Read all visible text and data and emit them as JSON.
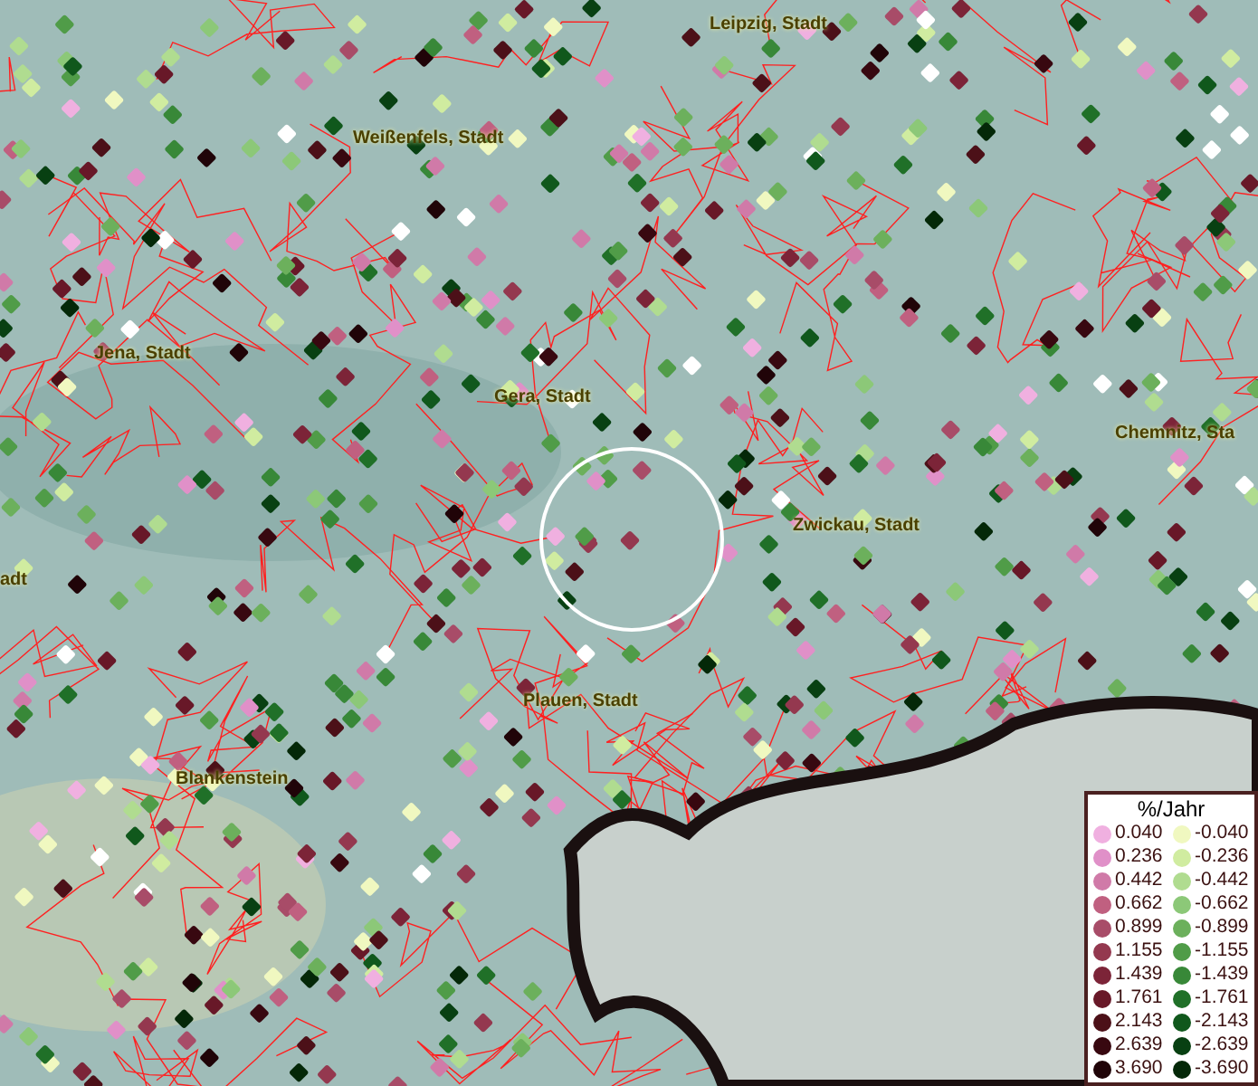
{
  "map": {
    "place_labels": [
      "Leipzig, Stadt",
      "Weißenfels, Stadt",
      "Jena, Stadt",
      "Gera, Stadt",
      "Chemnitz, Sta",
      "Zwickau, Stadt",
      "adt",
      "Plauen, Stadt",
      "Blankenstein"
    ]
  },
  "legend": {
    "title": "%/Jahr",
    "positive": [
      {
        "value": "0.040",
        "color": "#f0b0e0"
      },
      {
        "value": "0.236",
        "color": "#e090c8"
      },
      {
        "value": "0.442",
        "color": "#d07aa8"
      },
      {
        "value": "0.662",
        "color": "#c06080"
      },
      {
        "value": "0.899",
        "color": "#a84c68"
      },
      {
        "value": "1.155",
        "color": "#94384f"
      },
      {
        "value": "1.439",
        "color": "#7c2438"
      },
      {
        "value": "1.761",
        "color": "#681828"
      },
      {
        "value": "2.143",
        "color": "#4c1018"
      },
      {
        "value": "2.639",
        "color": "#380810"
      },
      {
        "value": "3.690",
        "color": "#200408"
      }
    ],
    "negative": [
      {
        "value": "-0.040",
        "color": "#f0f8c0"
      },
      {
        "value": "-0.236",
        "color": "#d0eca0"
      },
      {
        "value": "-0.442",
        "color": "#b0dc90"
      },
      {
        "value": "-0.662",
        "color": "#8cc878"
      },
      {
        "value": "-0.899",
        "color": "#6cb05c"
      },
      {
        "value": "-1.155",
        "color": "#509c48"
      },
      {
        "value": "-1.439",
        "color": "#388838"
      },
      {
        "value": "-1.761",
        "color": "#207028"
      },
      {
        "value": "-2.143",
        "color": "#10581c"
      },
      {
        "value": "-2.639",
        "color": "#084012"
      },
      {
        "value": "-3.690",
        "color": "#042808"
      }
    ]
  }
}
